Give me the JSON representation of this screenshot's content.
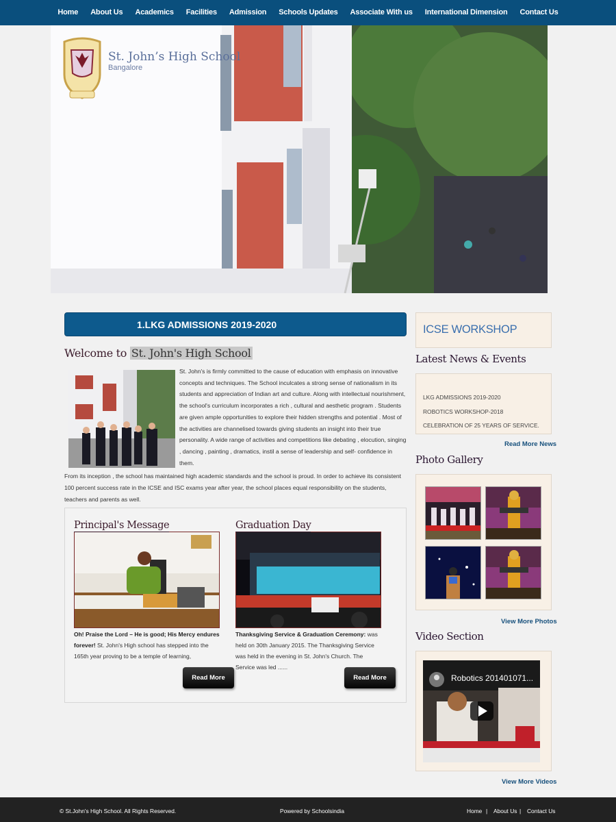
{
  "nav": [
    "Home",
    "About Us",
    "Academics",
    "Facilities",
    "Admission",
    "Schools Updates",
    "Associate With us",
    "International Dimension",
    "Contact Us"
  ],
  "brand": {
    "name": "St. John’s High School",
    "city": "Bangalore"
  },
  "banner": "1.LKG ADMISSIONS 2019-2020",
  "welcome": {
    "prefix": "Welcome to ",
    "highlight": "St. John's High School",
    "p1": "St. John's is firmly committed to the cause of education with emphasis on innovative concepts and techniques. The School inculcates a strong sense of nationalism in its students and appreciation of Indian art and culture. Along with intellectual nourishment, the school's curriculum incorporates a rich , cultural and aesthetic program . Students are given ample opportunities to explore their hidden strengths and potential . Most of the activities are channelised towards giving students an insight into their true personality. A wide range of activities and competitions like debating , elocution, singing , dancing , painting , dramatics, instil a sense of leadership and self- confidence in them.",
    "p2": "From its inception , the school has maintained high academic standards and the school is proud. In order to achieve its consistent 100 percent success rate in the ICSE and ISC exams year after year, the school places equal responsibility on the students, teachers and parents as well."
  },
  "principal": {
    "title": "Principal's Message",
    "bold": "Oh! Praise the Lord – He is good; His Mercy endures forever!",
    "text": " St. John's High school has stepped into the 165th year proving to be a temple of learning,",
    "button": "Read More"
  },
  "graduation": {
    "title": "Graduation Day",
    "bold": "Thanksgiving Service & Graduation Ceremony:",
    "text": " was held on 30th January 2015. The Thanksgiving Service was held in the evening in St. John's Church. The Service was led ......",
    "button": "Read More"
  },
  "sidebar": {
    "icse": "ICSE WORKSHOP",
    "news_title": "Latest News & Events",
    "news": [
      "LKG ADMISSIONS 2019-2020",
      "ROBOTICS WORKSHOP-2018",
      "CELEBRATION OF 25 YEARS OF SERVICE."
    ],
    "news_more": "Read More News",
    "gallery_title": "Photo Gallery",
    "gallery_more": "View More Photos",
    "video_title": "Video Section",
    "video_caption": "Robotics 201401071...",
    "video_more": "View More Videos"
  },
  "footer": {
    "copyright": "© St.John's High School. All Rights Reserved.",
    "powered": "Powered by Schoolsindia",
    "links": [
      "Home",
      "About Us",
      "Contact Us"
    ],
    "sep": "|"
  },
  "colors": {
    "nav": "#0a4f7d",
    "banner": "#0d5a8d",
    "panel": "#f8f0e6",
    "footer": "#222222",
    "link": "#17507c"
  }
}
